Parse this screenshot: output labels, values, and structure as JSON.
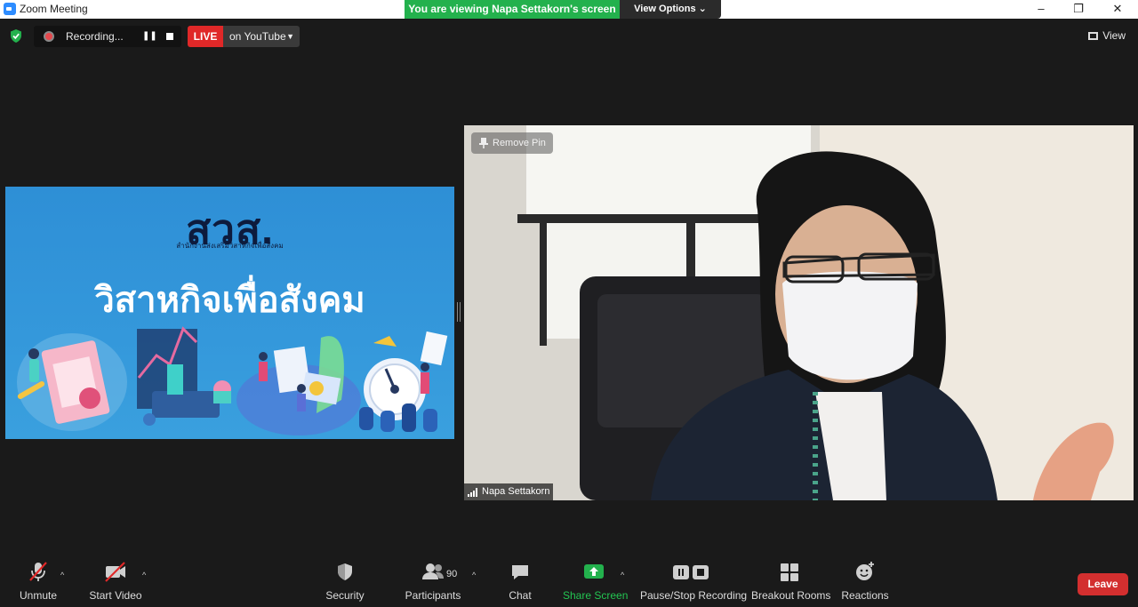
{
  "window": {
    "title": "Zoom Meeting",
    "minimize": "–",
    "restore": "❐",
    "close": "✕"
  },
  "banner": {
    "viewing_text": "You are viewing Napa Settakorn's screen",
    "view_options": "View Options ⌄"
  },
  "status": {
    "recording_text": "Recording...",
    "pause_glyph": "❚❚",
    "live_label": "LIVE",
    "live_target": "on YouTube",
    "live_caret": "▼",
    "view_label": "View"
  },
  "shared_screen": {
    "logo": "สวส.",
    "subline": "สำนักงานส่งเสริมวิสาหกิจเพื่อสังคม",
    "headline": "วิสาหกิจเพื่อสังคม"
  },
  "video": {
    "remove_pin": "Remove Pin",
    "participant_name": "Napa Settakorn"
  },
  "toolbar": {
    "unmute": "Unmute",
    "start_video": "Start Video",
    "security": "Security",
    "participants": "Participants",
    "participant_count": "90",
    "chat": "Chat",
    "share_screen": "Share Screen",
    "pause_stop_recording": "Pause/Stop Recording",
    "breakout_rooms": "Breakout Rooms",
    "reactions": "Reactions",
    "caret": "^",
    "leave": "Leave"
  },
  "colors": {
    "live_red": "#e02828",
    "share_green": "#23b14d",
    "leave_red": "#d32f2f",
    "brand_blue": "#2d8cff"
  }
}
